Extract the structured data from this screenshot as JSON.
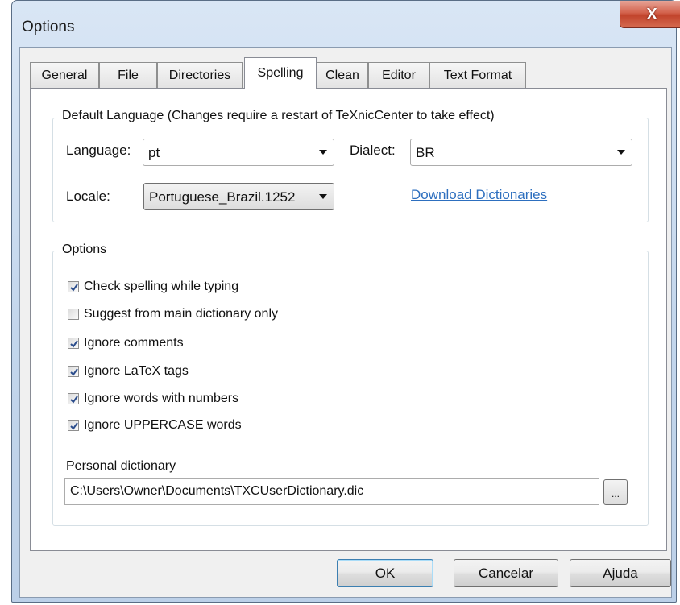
{
  "window": {
    "title": "Options",
    "close_glyph": "X"
  },
  "tabs": [
    {
      "label": "General"
    },
    {
      "label": "File"
    },
    {
      "label": "Directories"
    },
    {
      "label": "Spelling",
      "active": true
    },
    {
      "label": "Clean"
    },
    {
      "label": "Editor"
    },
    {
      "label": "Text Format"
    }
  ],
  "default_language": {
    "legend": "Default Language (Changes require a restart of TeXnicCenter to take effect)",
    "language_label": "Language:",
    "language_value": "pt",
    "dialect_label": "Dialect:",
    "dialect_value": "BR",
    "locale_label": "Locale:",
    "locale_value": "Portuguese_Brazil.1252",
    "download_link": "Download Dictionaries"
  },
  "options": {
    "legend": "Options",
    "checkboxes": [
      {
        "label": "Check spelling while typing",
        "checked": true
      },
      {
        "label": "Suggest from main dictionary only",
        "checked": false
      },
      {
        "label": "Ignore comments",
        "checked": true
      },
      {
        "label": "Ignore LaTeX tags",
        "checked": true
      },
      {
        "label": "Ignore words with numbers",
        "checked": true
      },
      {
        "label": "Ignore UPPERCASE words",
        "checked": true
      }
    ],
    "personal_dictionary_label": "Personal dictionary",
    "personal_dictionary_path": "C:\\Users\\Owner\\Documents\\TXCUserDictionary.dic",
    "browse_label": "..."
  },
  "buttons": {
    "ok": "OK",
    "cancel": "Cancelar",
    "help": "Ajuda"
  },
  "colors": {
    "link": "#2d6fbf",
    "close_button": "#c9513a",
    "default_button_border": "#3c7fb1"
  }
}
